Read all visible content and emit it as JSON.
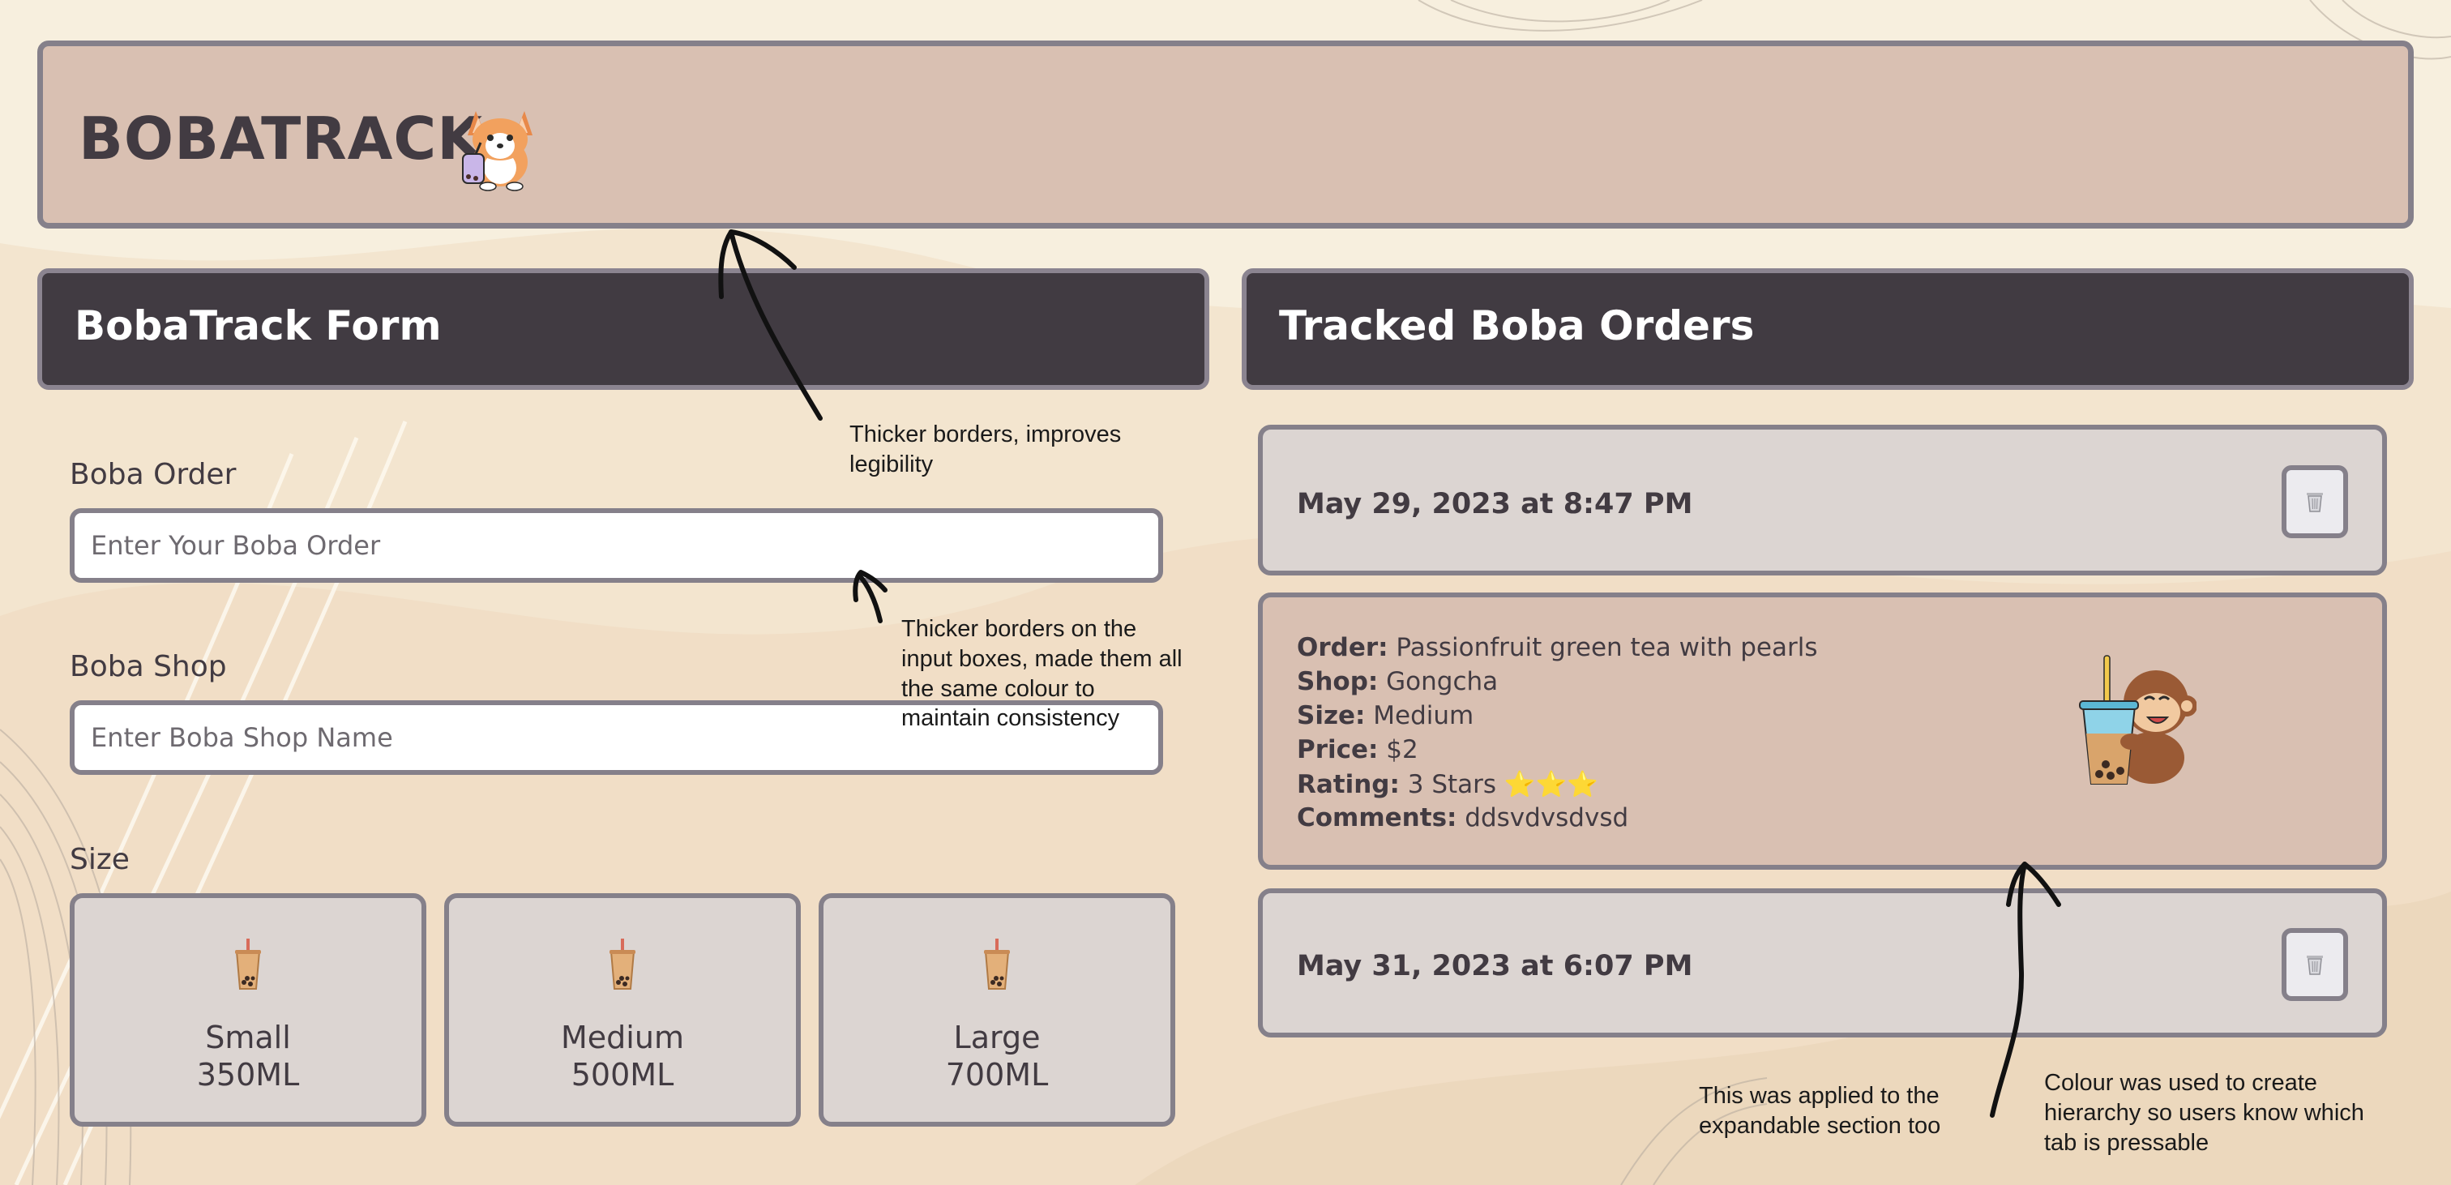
{
  "header": {
    "title": "BOBATRACK",
    "mascot_icon": "corgi-with-boba-icon"
  },
  "form": {
    "title": "BobaTrack Form",
    "order_label": "Boba Order",
    "order_placeholder": "Enter Your Boba Order",
    "shop_label": "Boba Shop",
    "shop_placeholder": "Enter Boba Shop Name",
    "size_label": "Size",
    "sizes": [
      {
        "name": "Small",
        "volume": "350ML",
        "icon": "bubble-tea-icon"
      },
      {
        "name": "Medium",
        "volume": "500ML",
        "icon": "bubble-tea-icon"
      },
      {
        "name": "Large",
        "volume": "700ML",
        "icon": "bubble-tea-icon"
      }
    ]
  },
  "orders": {
    "title": "Tracked Boba Orders",
    "entries": [
      {
        "date": "May 29, 2023 at 8:47 PM",
        "expanded": true,
        "details": {
          "order_label": "Order:",
          "order": "Passionfruit green tea with pearls",
          "shop_label": "Shop:",
          "shop": "Gongcha",
          "size_label": "Size:",
          "size": "Medium",
          "price_label": "Price:",
          "price": "$2",
          "rating_label": "Rating:",
          "rating": "3 Stars ⭐⭐⭐",
          "comments_label": "Comments:",
          "comments": "ddsvdvsdvsd"
        }
      },
      {
        "date": "May 31, 2023 at 6:07 PM",
        "expanded": false
      }
    ]
  },
  "annotations": {
    "thicker_borders": "Thicker borders, improves legibility",
    "input_boxes": "Thicker borders on the input boxes, made them all the same colour to maintain consistency",
    "expandable": "This was applied to the expandable section too",
    "colour_hierarchy": "Colour was used to create hierarchy so users know which tab is pressable"
  },
  "colors": {
    "background": "#f3e5cf",
    "header": "#d9c0b2",
    "dark_panel": "#413b42",
    "card": "#dcd5d2",
    "border": "#85808a"
  }
}
